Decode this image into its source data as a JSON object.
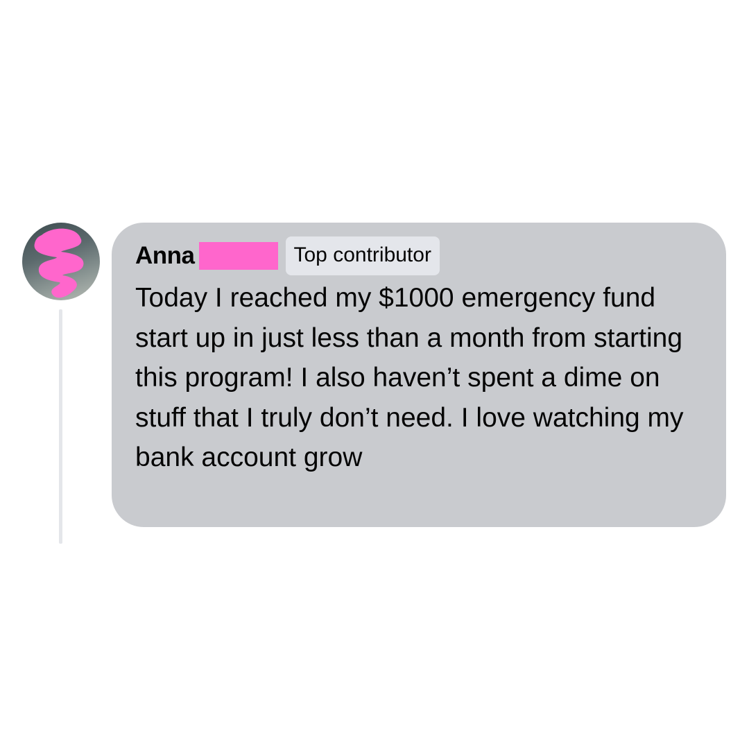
{
  "comment": {
    "author": "Anna",
    "badge": "Top contributor",
    "text": "Today I reached my $1000 emergency fund start up in just less than a month from starting this program! I also haven’t spent a dime on stuff that I truly don’t need. I love watching my bank account grow"
  },
  "icons": {
    "avatar": "profile-photo-redacted"
  },
  "colors": {
    "bubble": "#c9cbcf",
    "badge_bg": "#e4e6eb",
    "redaction": "#ff66cc",
    "thread_line": "#e4e6ea"
  }
}
